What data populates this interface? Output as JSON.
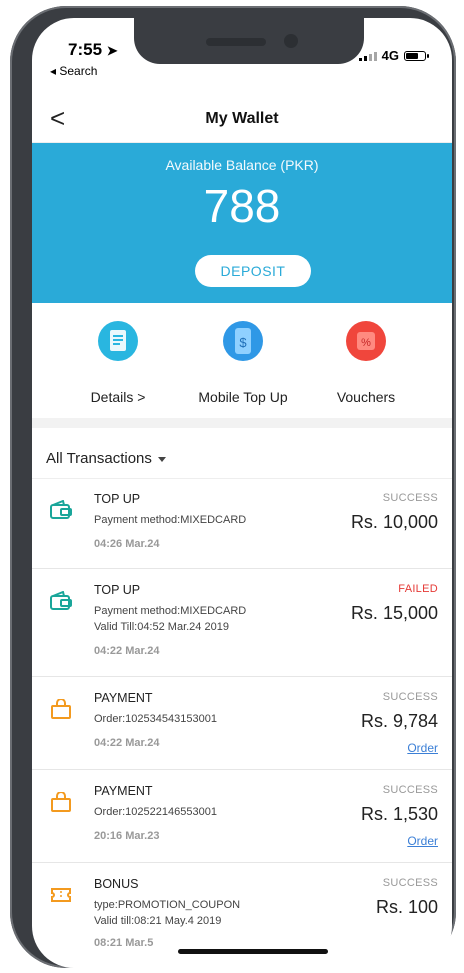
{
  "status_bar": {
    "time": "7:55",
    "back_app": "◂ Search",
    "network": "4G"
  },
  "nav": {
    "back_glyph": "<",
    "title": "My Wallet"
  },
  "balance": {
    "label": "Available Balance (PKR)",
    "amount": "788",
    "deposit_label": "DEPOSIT",
    "bg_color": "#2aaad8"
  },
  "actions": [
    {
      "label": "Details >",
      "icon": "document-icon",
      "color": "#29b6e0"
    },
    {
      "label": "Mobile Top Up",
      "icon": "mobile-topup-icon",
      "color": "#2f98e6"
    },
    {
      "label": "Vouchers",
      "icon": "voucher-icon",
      "color": "#f0463c"
    }
  ],
  "filter": {
    "label": "All Transactions"
  },
  "transactions": [
    {
      "type": "TOP UP",
      "icon": "wallet-icon",
      "line1": "Payment method:MIXEDCARD",
      "line2": "",
      "time": "04:26 Mar.24",
      "status": "SUCCESS",
      "amount": "Rs. 10,000",
      "link": ""
    },
    {
      "type": "TOP UP",
      "icon": "wallet-icon",
      "line1": "Payment method:MIXEDCARD",
      "line2": "Valid Till:04:52 Mar.24 2019",
      "time": "04:22 Mar.24",
      "status": "FAILED",
      "amount": "Rs. 15,000",
      "link": ""
    },
    {
      "type": "PAYMENT",
      "icon": "shopping-bag-icon",
      "line1": "Order:102534543153001",
      "line2": "",
      "time": "04:22 Mar.24",
      "status": "SUCCESS",
      "amount": "Rs. 9,784",
      "link": "Order"
    },
    {
      "type": "PAYMENT",
      "icon": "shopping-bag-icon",
      "line1": "Order:102522146553001",
      "line2": "",
      "time": "20:16 Mar.23",
      "status": "SUCCESS",
      "amount": "Rs. 1,530",
      "link": "Order"
    },
    {
      "type": "BONUS",
      "icon": "coupon-icon",
      "line1": "type:PROMOTION_COUPON",
      "line2": "Valid till:08:21 May.4 2019",
      "time": "08:21 Mar.5",
      "status": "SUCCESS",
      "amount": "Rs. 100",
      "link": ""
    }
  ],
  "colors": {
    "teal_icon": "#1aa69a",
    "orange_icon": "#f39a1f",
    "failed": "#e53935",
    "link": "#3b7fd6"
  }
}
